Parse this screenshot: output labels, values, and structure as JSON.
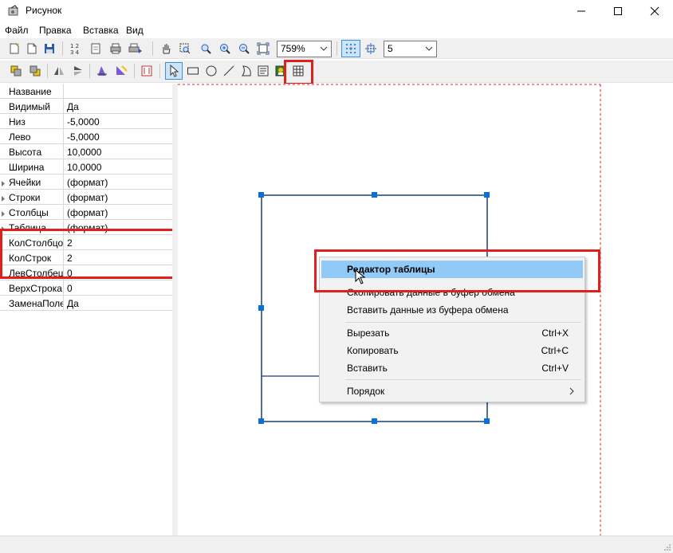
{
  "window": {
    "title": "Рисунок",
    "controls": [
      "minimize",
      "maximize",
      "close"
    ]
  },
  "menubar": [
    "Файл",
    "Правка",
    "Вставка",
    "Вид"
  ],
  "toolbar1": {
    "zoom_value": "759%",
    "grid_value": "5"
  },
  "toolbar2": {
    "highlighted_tool": "table-icon"
  },
  "properties": [
    {
      "name": "Название",
      "value": "",
      "expandable": false
    },
    {
      "name": "Видимый",
      "value": "Да",
      "expandable": false
    },
    {
      "name": "Низ",
      "value": "-5,0000",
      "expandable": false
    },
    {
      "name": "Лево",
      "value": "-5,0000",
      "expandable": false
    },
    {
      "name": "Высота",
      "value": "10,0000",
      "expandable": false
    },
    {
      "name": "Ширина",
      "value": "10,0000",
      "expandable": false
    },
    {
      "name": "Ячейки",
      "value": "(формат)",
      "expandable": true
    },
    {
      "name": "Строки",
      "value": "(формат)",
      "expandable": true
    },
    {
      "name": "Столбцы",
      "value": "(формат)",
      "expandable": true
    },
    {
      "name": "Таблица",
      "value": "(формат)",
      "expandable": true
    },
    {
      "name": "КолСтолбцов",
      "value": "2",
      "expandable": false
    },
    {
      "name": "КолСтрок",
      "value": "2",
      "expandable": false
    },
    {
      "name": "ЛевСтолбец",
      "value": "0",
      "expandable": false
    },
    {
      "name": "ВерхСтрока",
      "value": "0",
      "expandable": false
    },
    {
      "name": "ЗаменаПолей",
      "value": "Да",
      "expandable": false
    }
  ],
  "context_menu": {
    "items": [
      {
        "label": "Редактор таблицы",
        "shortcut": "",
        "highlighted": true
      },
      {
        "label": "Скопировать данные в буфер обмена",
        "shortcut": ""
      },
      {
        "label": "Вставить данные из буфера обмена",
        "shortcut": ""
      },
      {
        "label": "Вырезать",
        "shortcut": "Ctrl+X"
      },
      {
        "label": "Копировать",
        "shortcut": "Ctrl+C"
      },
      {
        "label": "Вставить",
        "shortcut": "Ctrl+V"
      },
      {
        "label": "Порядок",
        "shortcut": "",
        "submenu": true
      }
    ]
  },
  "colors": {
    "highlight_red": "#e0201c",
    "menu_hover": "#91c9f7",
    "selection_handle": "#0a6fd6",
    "page_border": "#e0201c"
  }
}
